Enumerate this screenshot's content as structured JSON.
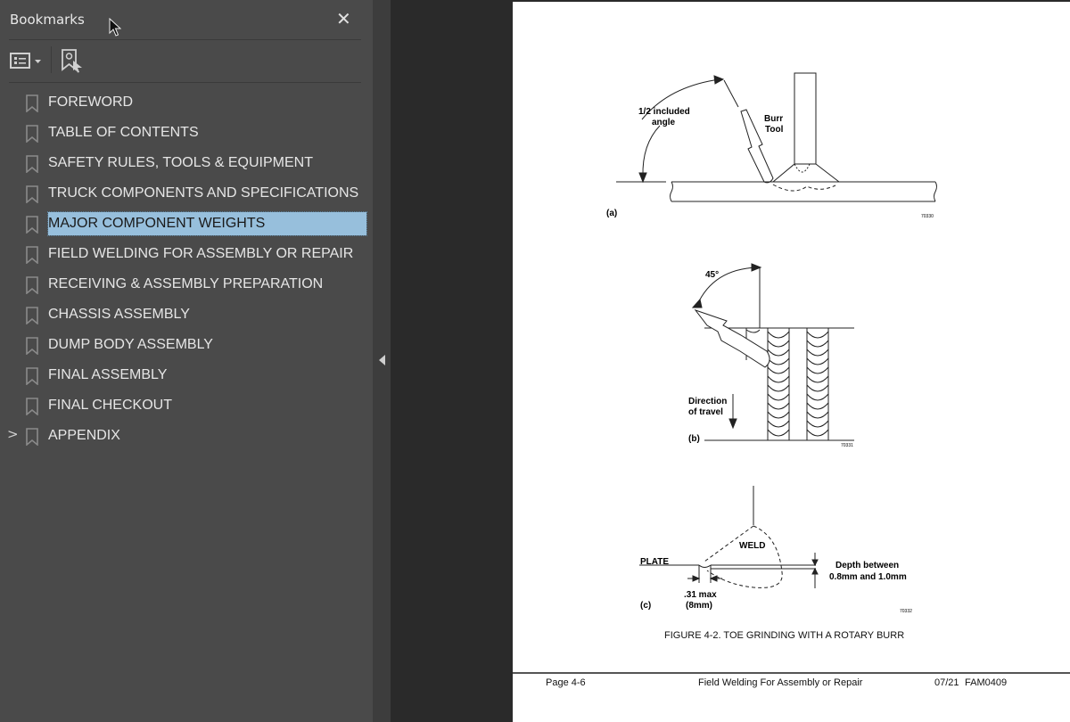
{
  "sidebar": {
    "title": "Bookmarks",
    "close_icon": "close-icon",
    "tools": {
      "options_icon": "list-options-icon",
      "add_bookmark_icon": "add-bookmark-icon"
    },
    "items": [
      {
        "label": "FOREWORD",
        "expandable": false,
        "selected": false
      },
      {
        "label": "TABLE OF CONTENTS",
        "expandable": false,
        "selected": false
      },
      {
        "label": "SAFETY RULES, TOOLS & EQUIPMENT",
        "expandable": false,
        "selected": false
      },
      {
        "label": "TRUCK COMPONENTS AND SPECIFICATIONS",
        "expandable": false,
        "selected": false
      },
      {
        "label": "MAJOR COMPONENT WEIGHTS",
        "expandable": false,
        "selected": true
      },
      {
        "label": "FIELD WELDING FOR ASSEMBLY OR REPAIR",
        "expandable": false,
        "selected": false
      },
      {
        "label": "RECEIVING & ASSEMBLY PREPARATION",
        "expandable": false,
        "selected": false
      },
      {
        "label": "CHASSIS ASSEMBLY",
        "expandable": false,
        "selected": false
      },
      {
        "label": "DUMP BODY ASSEMBLY",
        "expandable": false,
        "selected": false
      },
      {
        "label": "FINAL ASSEMBLY",
        "expandable": false,
        "selected": false
      },
      {
        "label": "FINAL CHECKOUT",
        "expandable": false,
        "selected": false
      },
      {
        "label": "APPENDIX",
        "expandable": true,
        "selected": false
      }
    ],
    "expander_glyph": ">"
  },
  "splitter": {
    "collapse_icon": "collapse-left-icon"
  },
  "document": {
    "figure_a": {
      "angle_label_1": "1/2 included",
      "angle_label_2": "angle",
      "tool_label_1": "Burr",
      "tool_label_2": "Tool",
      "panel": "(a)",
      "ref": "70330"
    },
    "figure_b": {
      "angle": "45°",
      "direction_1": "Direction",
      "direction_2": "of travel",
      "panel": "(b)",
      "ref": "70331"
    },
    "figure_c": {
      "weld": "WELD",
      "plate": "PLATE",
      "depth_1": "Depth between",
      "depth_2": "0.8mm and 1.0mm",
      "max_1": ".31 max",
      "max_2": "(8mm)",
      "panel": "(c)",
      "ref": "70332"
    },
    "caption": "FIGURE 4-2. TOE GRINDING WITH A ROTARY BURR",
    "footer": {
      "page": "Page 4-6",
      "section": "Field Welding For Assembly or Repair",
      "date": "07/21",
      "doc_id": "FAM0409"
    }
  }
}
